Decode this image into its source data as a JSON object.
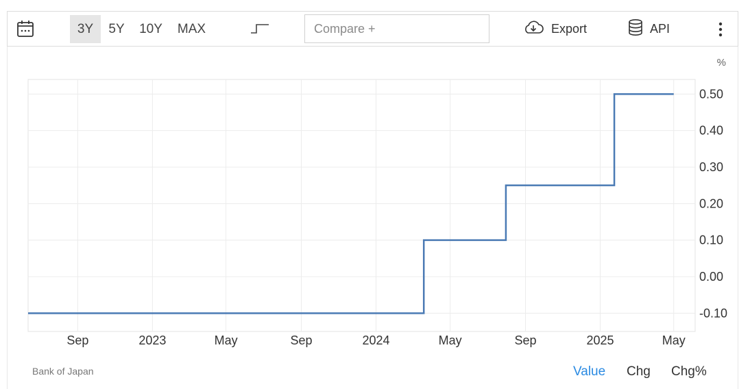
{
  "toolbar": {
    "calendar_icon": "calendar-icon",
    "ranges": [
      {
        "label": "3Y",
        "active": true
      },
      {
        "label": "5Y",
        "active": false
      },
      {
        "label": "10Y",
        "active": false
      },
      {
        "label": "MAX",
        "active": false
      }
    ],
    "step_chart_icon": "step-line-icon",
    "compare_placeholder": "Compare +",
    "export_label": "Export",
    "export_icon": "cloud-download-icon",
    "api_label": "API",
    "api_icon": "database-icon",
    "more_icon": "vertical-dots-icon"
  },
  "chart_data": {
    "type": "line",
    "step": true,
    "unit": "%",
    "x_tick_labels": [
      "Sep",
      "2023",
      "May",
      "Sep",
      "2024",
      "May",
      "Sep",
      "2025",
      "May"
    ],
    "y_tick_labels": [
      "0.50",
      "0.40",
      "0.30",
      "0.20",
      "0.10",
      "0.00",
      "-0.10"
    ],
    "ylim": [
      -0.15,
      0.54
    ],
    "xlim": [
      "2022-06-12",
      "2025-06-05"
    ],
    "x_ticks": [
      "2022-09-01",
      "2023-01-01",
      "2023-05-01",
      "2023-09-01",
      "2024-01-01",
      "2024-05-01",
      "2024-09-01",
      "2025-01-01",
      "2025-05-01"
    ],
    "y_ticks": [
      0.5,
      0.4,
      0.3,
      0.2,
      0.1,
      0.0,
      -0.1
    ],
    "grid": true,
    "line_color": "#4a7ab4",
    "series": [
      {
        "points": [
          {
            "x": "2022-06-12",
            "y": -0.1
          },
          {
            "x": "2024-03-19",
            "y": 0.1
          },
          {
            "x": "2024-07-31",
            "y": 0.25
          },
          {
            "x": "2025-01-24",
            "y": 0.5
          },
          {
            "x": "2025-05-01",
            "y": 0.5
          }
        ]
      }
    ]
  },
  "footer": {
    "source": "Bank of Japan",
    "tabs": [
      {
        "label": "Value",
        "active": true
      },
      {
        "label": "Chg",
        "active": false
      },
      {
        "label": "Chg%",
        "active": false
      }
    ]
  },
  "colors": {
    "accent": "#2a8ae2",
    "active_range_bg": "#e6e6e6",
    "grid": "#ececec"
  }
}
